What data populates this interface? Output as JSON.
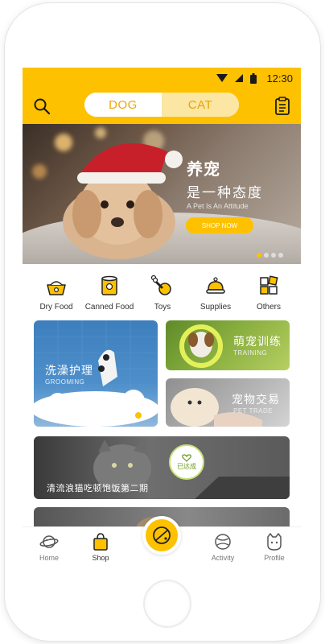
{
  "status_bar": {
    "time": "12:30",
    "icons": [
      "wifi-icon",
      "signal-icon",
      "battery-icon"
    ]
  },
  "header": {
    "toggle": {
      "dog_label": "DOG",
      "cat_label": "CAT",
      "selected": "DOG"
    },
    "icons": [
      "search-icon",
      "list-icon"
    ]
  },
  "banner": {
    "title": "养宠",
    "subtitle": "是一种态度",
    "tagline": "A Pet Is An Attitude",
    "button_label": "SHOP NOW",
    "slide_count": 4,
    "active_slide": 1
  },
  "categories": [
    {
      "label": "Dry Food",
      "icon": "dry-food-bowl-icon"
    },
    {
      "label": "Canned Food",
      "icon": "canned-food-icon"
    },
    {
      "label": "Toys",
      "icon": "toys-icon"
    },
    {
      "label": "Supplies",
      "icon": "supplies-icon"
    },
    {
      "label": "Others",
      "icon": "others-grid-icon"
    }
  ],
  "cards": {
    "grooming": {
      "title": "洗澡护理",
      "subtitle": "GROOMING"
    },
    "training": {
      "title": "萌宠训练",
      "subtitle": "TRAINING"
    },
    "trade": {
      "title": "宠物交易",
      "subtitle": "PET TRADE"
    },
    "charity": {
      "title": "清流浪猫吃顿饱饭第二期",
      "badge": "已达成"
    }
  },
  "tabbar": {
    "items": [
      {
        "label": "Home",
        "icon": "planet-icon"
      },
      {
        "label": "Shop",
        "icon": "shopping-bag-icon"
      },
      {
        "label": "Activity",
        "icon": "ball-icon"
      },
      {
        "label": "Profile",
        "icon": "cat-face-icon"
      }
    ],
    "active": "Shop",
    "center_icon": "center-action-icon"
  },
  "colors": {
    "accent": "#fdc100",
    "dog_text": "#f0a500",
    "cat_bg": "#fbe6a4"
  }
}
